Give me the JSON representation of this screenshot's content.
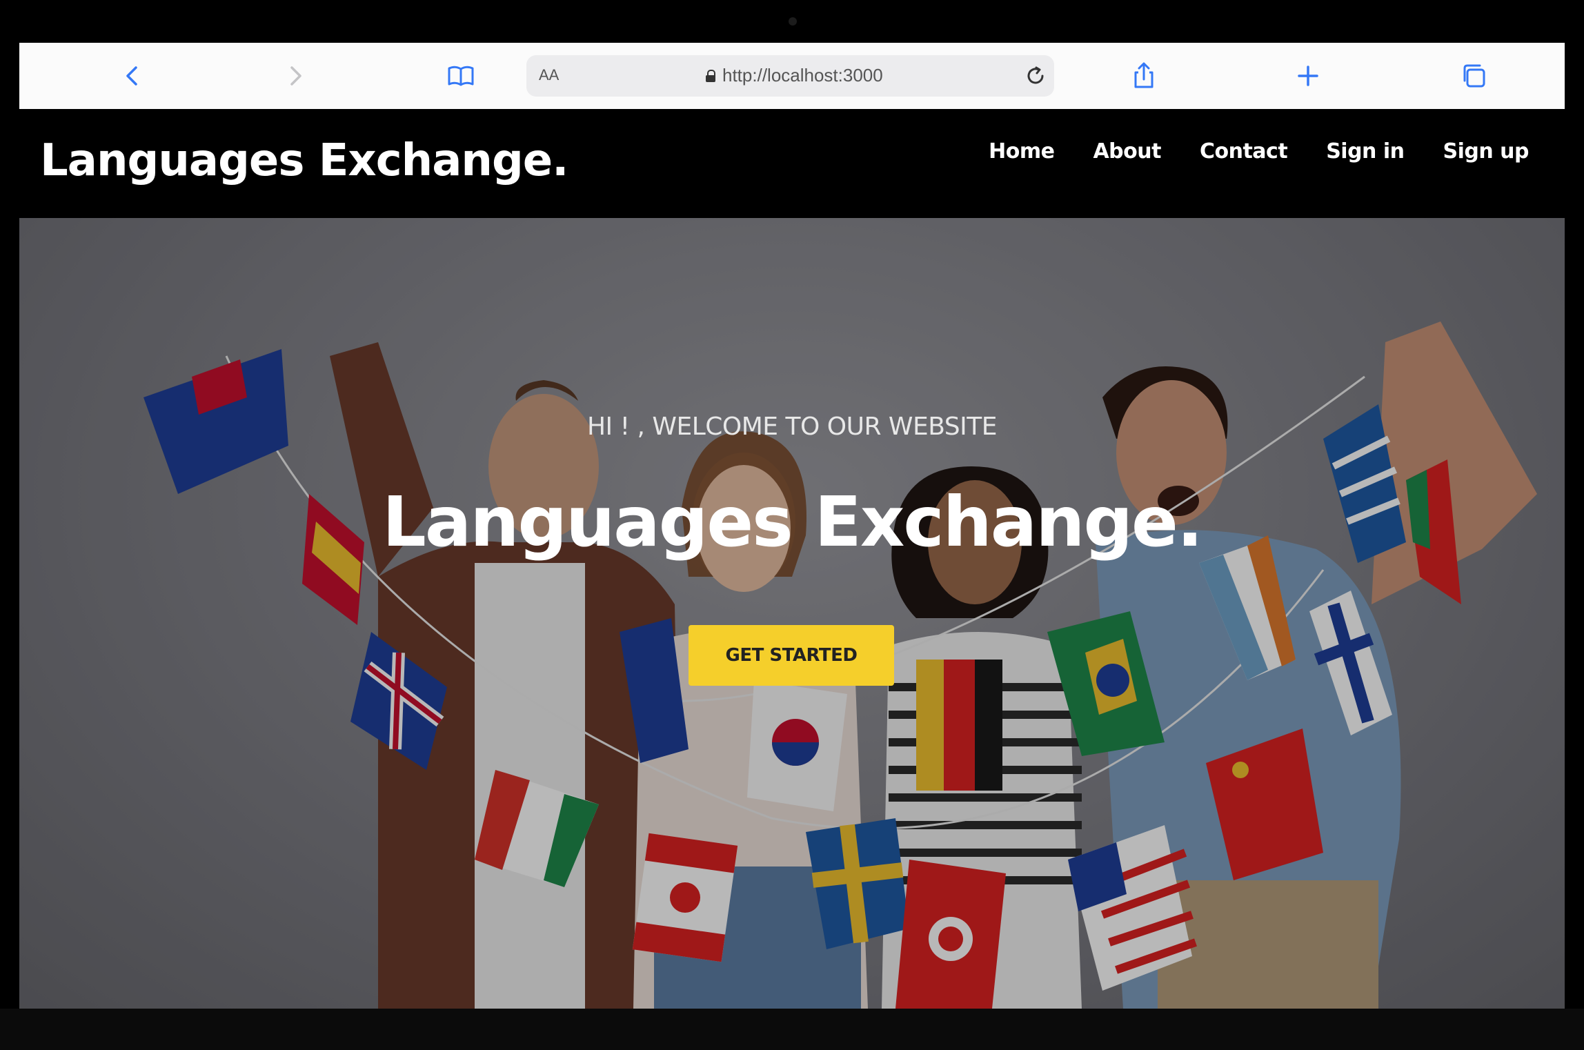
{
  "browser": {
    "reader_label": "AA",
    "url": "http://localhost:3000",
    "icons": [
      "back-icon",
      "forward-icon",
      "bookmarks-icon",
      "lock-icon",
      "reload-icon",
      "share-icon",
      "new-tab-icon",
      "tabs-icon"
    ]
  },
  "site": {
    "brand": "Languages Exchange.",
    "nav": [
      "Home",
      "About",
      "Contact",
      "Sign in",
      "Sign up"
    ]
  },
  "hero": {
    "welcome": "HI ! , WELCOME TO OUR WEBSITE",
    "title": "Languages Exchange.",
    "cta_label": "GET STARTED",
    "cta_color": "#f5cf2b",
    "image_description_icon": "people-with-flags-photo"
  }
}
